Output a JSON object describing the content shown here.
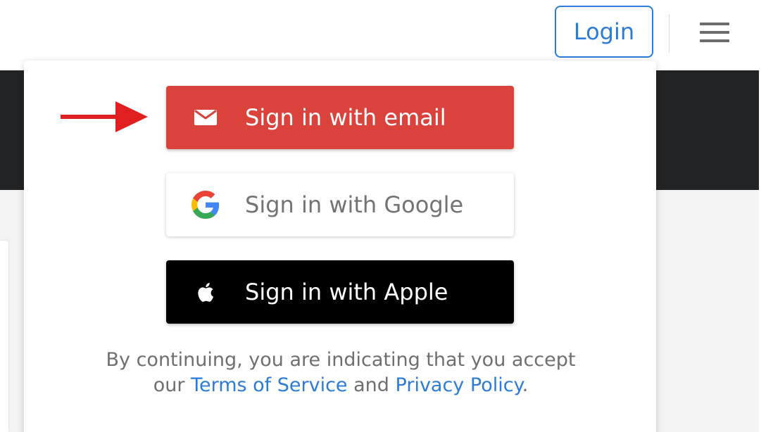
{
  "header": {
    "login_label": "Login",
    "menu_icon": "hamburger-menu-icon"
  },
  "signin": {
    "email_label": "Sign in with email",
    "google_label": "Sign in with Google",
    "apple_label": "Sign in with Apple",
    "email_icon": "envelope-icon",
    "google_icon": "google-logo-icon",
    "apple_icon": "apple-logo-icon"
  },
  "legal": {
    "line1": "By continuing, you are indicating that you accept",
    "our": "our",
    "terms_link": "Terms of Service",
    "and": "and",
    "privacy_link": "Privacy Policy",
    "period": "."
  },
  "colors": {
    "accent_blue": "#2b7bd9",
    "email_red": "#db423c",
    "apple_black": "#000000",
    "arrow_red": "#e02020"
  },
  "annotation": {
    "arrow_icon": "red-arrow-icon"
  }
}
